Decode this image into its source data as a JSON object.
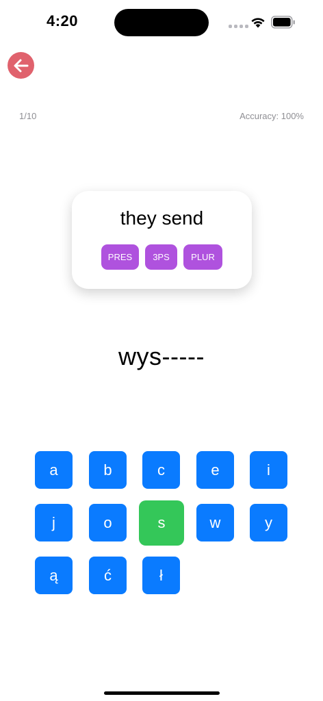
{
  "status_bar": {
    "time": "4:20",
    "icons": [
      "signal-dots-icon",
      "wifi-icon",
      "battery-icon"
    ]
  },
  "header": {
    "back_icon": "arrow-left-icon",
    "back_color": "#e0626d"
  },
  "progress": {
    "count": "1/10",
    "accuracy": "Accuracy: 100%"
  },
  "prompt": {
    "text": "they send",
    "tags": [
      "PRES",
      "3PS",
      "PLUR"
    ],
    "tag_color": "#af52de"
  },
  "answer": {
    "text": "wys-----"
  },
  "keyboard": {
    "key_color": "#0a7bff",
    "selected_color": "#34c759",
    "selected_key": "s",
    "rows": [
      [
        "a",
        "b",
        "c",
        "e",
        "i"
      ],
      [
        "j",
        "o",
        "s",
        "w",
        "y"
      ],
      [
        "ą",
        "ć",
        "ł"
      ]
    ]
  }
}
